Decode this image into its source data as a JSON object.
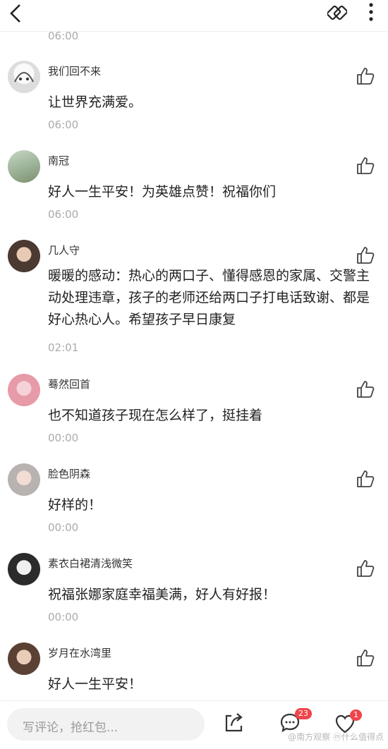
{
  "header": {
    "top_time": "06:00"
  },
  "comments": [
    {
      "user": "我们回不来",
      "text": "让世界充满爱。",
      "time": "06:00"
    },
    {
      "user": "南冠",
      "text": "好人一生平安！为英雄点赞！祝福你们",
      "time": "06:00"
    },
    {
      "user": "几人守",
      "text": "暖暖的感动：热心的两口子、懂得感恩的家属、交警主动处理违章，孩子的老师还给两口子打电话致谢、都是好心热心人。希望孩子早日康复",
      "time": "02:01"
    },
    {
      "user": "蓦然回首",
      "text": "也不知道孩子现在怎么样了，挺挂着",
      "time": "00:00"
    },
    {
      "user": "脸色阴森",
      "text": "好样的！",
      "time": "00:00"
    },
    {
      "user": "素衣白裙清浅微笑",
      "text": "祝福张娜家庭幸福美满，好人有好报！",
      "time": "00:00"
    },
    {
      "user": "岁月在水湾里",
      "text": "好人一生平安！",
      "time": ""
    }
  ],
  "bottom": {
    "input_placeholder": "写评论，抢红包...",
    "comment_count": "23",
    "like_count": "1",
    "watermark": "@南方观察 ⓜ什么值得点"
  },
  "colors": {
    "badge": "#f0454a",
    "muted": "#aaaaaa"
  }
}
